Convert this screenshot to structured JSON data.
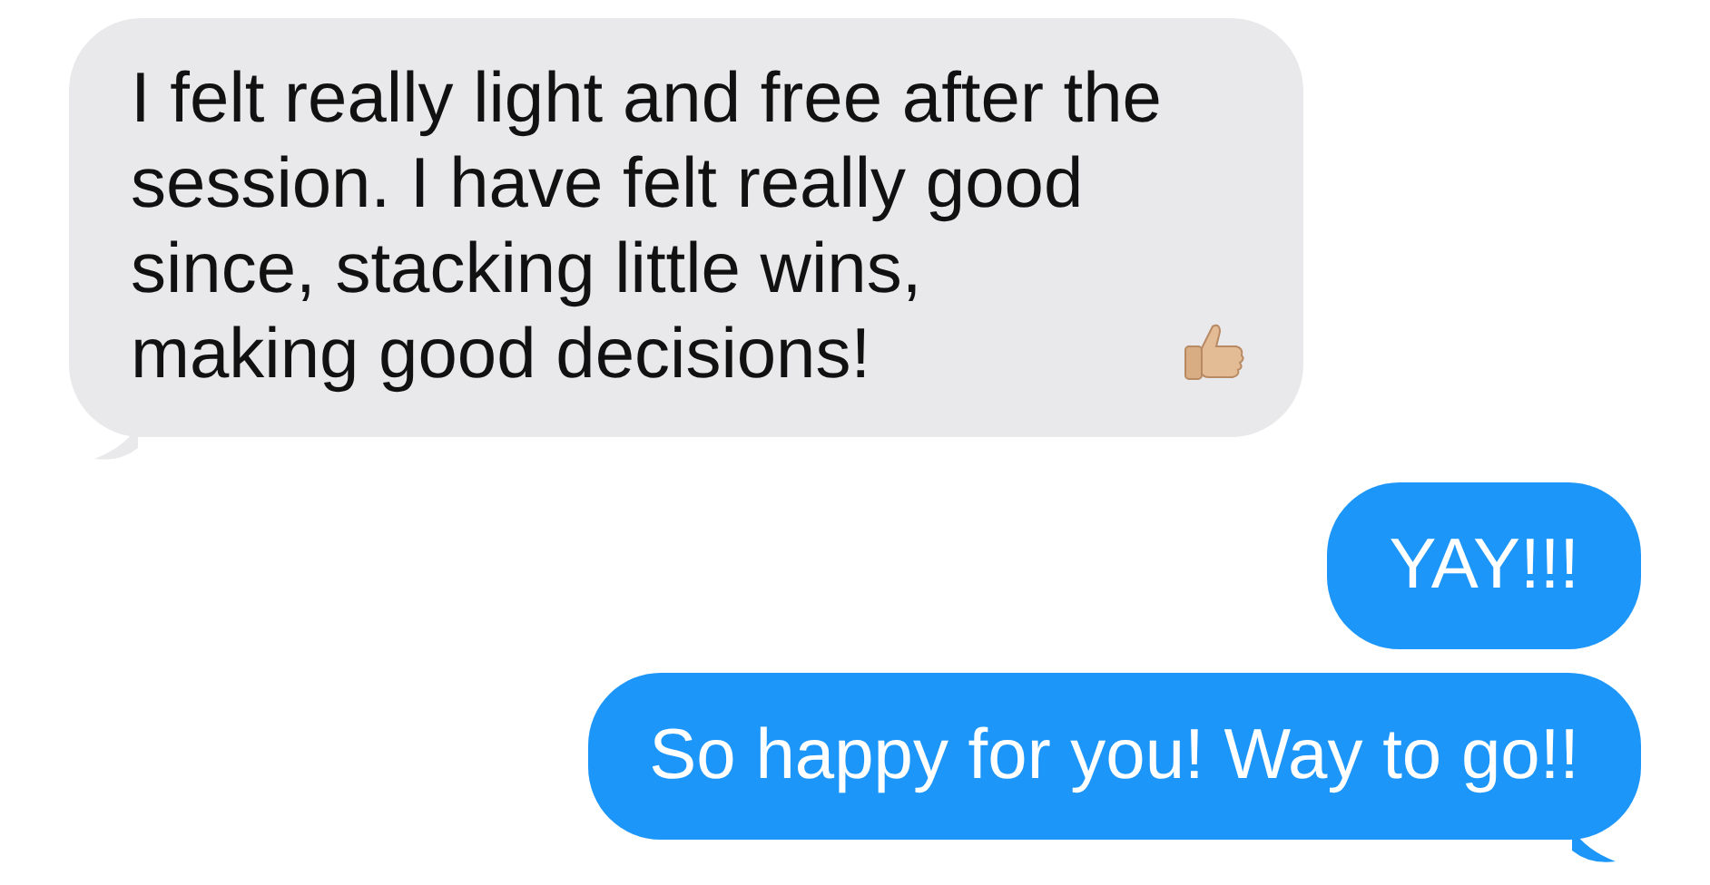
{
  "messages": [
    {
      "kind": "incoming",
      "text": "I felt really light and free after the\nsession. I have felt really good\nsince, stacking little wins,\nmaking good decisions!",
      "thumbs_up": true,
      "tail": true
    },
    {
      "kind": "outgoing",
      "text": "YAY!!!",
      "thumbs_up": false,
      "tail": false
    },
    {
      "kind": "outgoing",
      "text": "So happy for you! Way to go!!",
      "thumbs_up": false,
      "tail": true
    }
  ]
}
